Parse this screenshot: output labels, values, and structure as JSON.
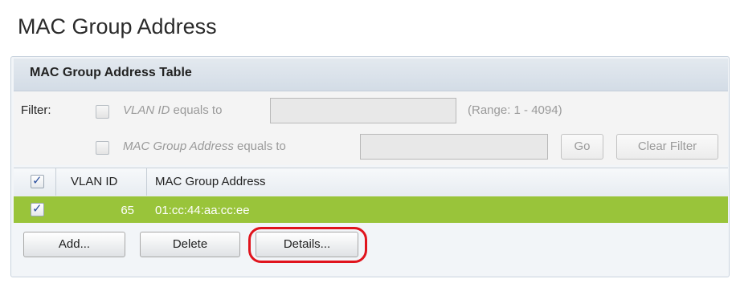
{
  "page": {
    "title": "MAC Group Address"
  },
  "panel": {
    "title": "MAC Group Address Table"
  },
  "filter": {
    "label": "Filter:",
    "vlan": {
      "field_name": "VLAN ID",
      "operator": "equals to",
      "value": "",
      "range_hint": "(Range: 1 - 4094)",
      "checked": false
    },
    "mac": {
      "field_name": "MAC Group Address",
      "operator": "equals to",
      "value": "",
      "checked": false
    },
    "go_label": "Go",
    "clear_label": "Clear Filter"
  },
  "table": {
    "columns": [
      "VLAN ID",
      "MAC Group Address"
    ],
    "select_all_checked": true,
    "rows": [
      {
        "vlan_id": "65",
        "mac_group_address": "01:cc:44:aa:cc:ee",
        "selected": true
      }
    ]
  },
  "actions": {
    "add_label": "Add...",
    "delete_label": "Delete",
    "details_label": "Details..."
  },
  "colors": {
    "selected_row": "#99c43a",
    "highlight_ring": "#e0141d"
  }
}
